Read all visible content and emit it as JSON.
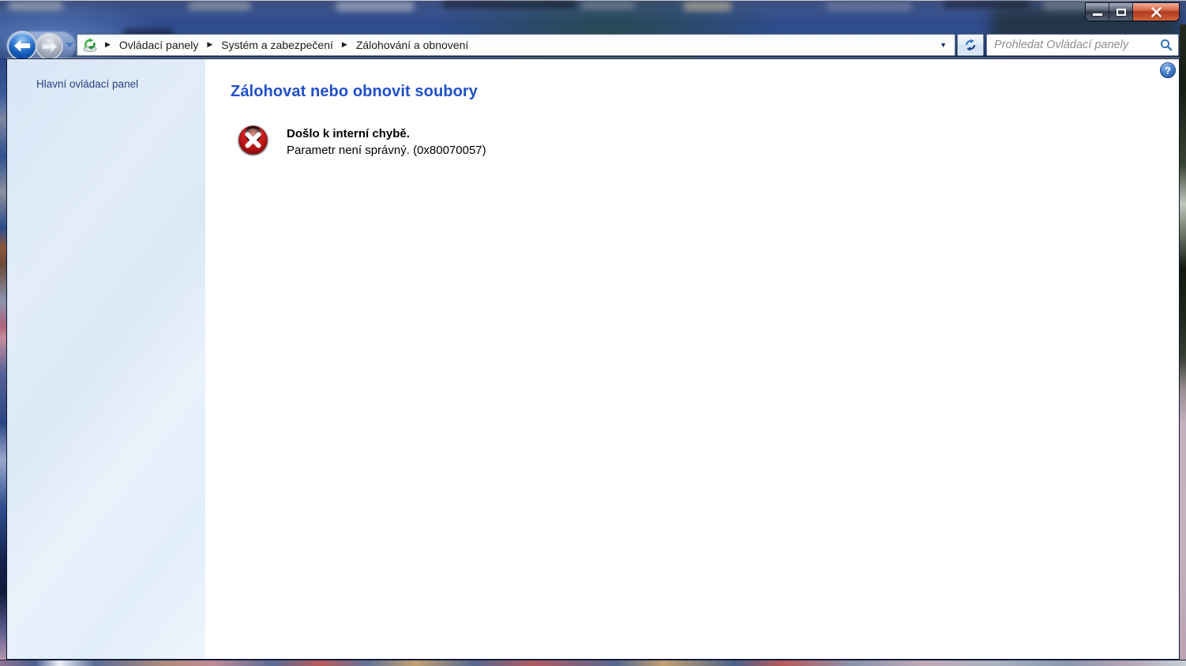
{
  "window": {
    "help_glyph": "?",
    "controls": {
      "minimize_icon": "minimize-dash",
      "maximize_icon": "maximize-square",
      "close_icon": "close-x"
    }
  },
  "navigation": {
    "back_icon": "arrow-left",
    "forward_icon": "arrow-right",
    "history_dropdown_icon": "chevron-down",
    "address": {
      "app_icon": "backup-restore-icon",
      "separator_glyph": "▶",
      "dropdown_glyph": "▼",
      "breadcrumb": [
        "Ovládací panely",
        "Systém a zabezpečení",
        "Zálohování a obnovení"
      ]
    },
    "refresh_icon": "refresh-arrows",
    "search": {
      "placeholder": "Prohledat Ovládací panely",
      "icon": "magnifier"
    }
  },
  "sidebar": {
    "items": [
      {
        "label": "Hlavní ovládací panel"
      }
    ]
  },
  "main": {
    "title": "Zálohovat nebo obnovit soubory",
    "error": {
      "icon": "error-red-circle-x",
      "title": "Došlo k interní chybě.",
      "message": "Parametr není správný. (0x80070057)"
    }
  },
  "colors": {
    "heading_blue": "#2150c8",
    "sidebar_text": "#26437f",
    "error_red": "#b51e1e",
    "glass_navy": "#2a4a90",
    "sidebar_bg": "#e2edf9",
    "close_button_red": "#c14f2b"
  }
}
